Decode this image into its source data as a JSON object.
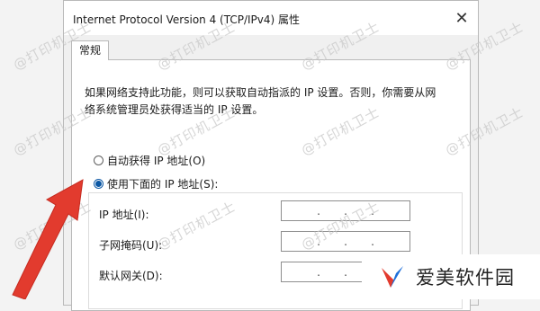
{
  "dialog": {
    "title": "Internet Protocol Version 4 (TCP/IPv4) 属性",
    "close_icon": "close-icon"
  },
  "tabs": [
    {
      "label": "常规"
    }
  ],
  "description": {
    "line1": "如果网络支持此功能，则可以获取自动指派的 IP 设置。否则，你需要从网",
    "line2": "络系统管理员处获得适当的 IP 设置。"
  },
  "options": {
    "auto": {
      "label": "自动获得 IP 地址(O)",
      "checked": false
    },
    "manual": {
      "label": "使用下面的 IP 地址(S):",
      "checked": true
    }
  },
  "fields": [
    {
      "label": "IP 地址(I):",
      "value": ". . ."
    },
    {
      "label": "子网掩码(U):",
      "value": ". . ."
    },
    {
      "label": "默认网关(D):",
      "value": ". . ."
    }
  ],
  "watermark_text": "@打印机卫士",
  "brand": {
    "name": "爱美软件园",
    "accent": "#e23b2e"
  }
}
